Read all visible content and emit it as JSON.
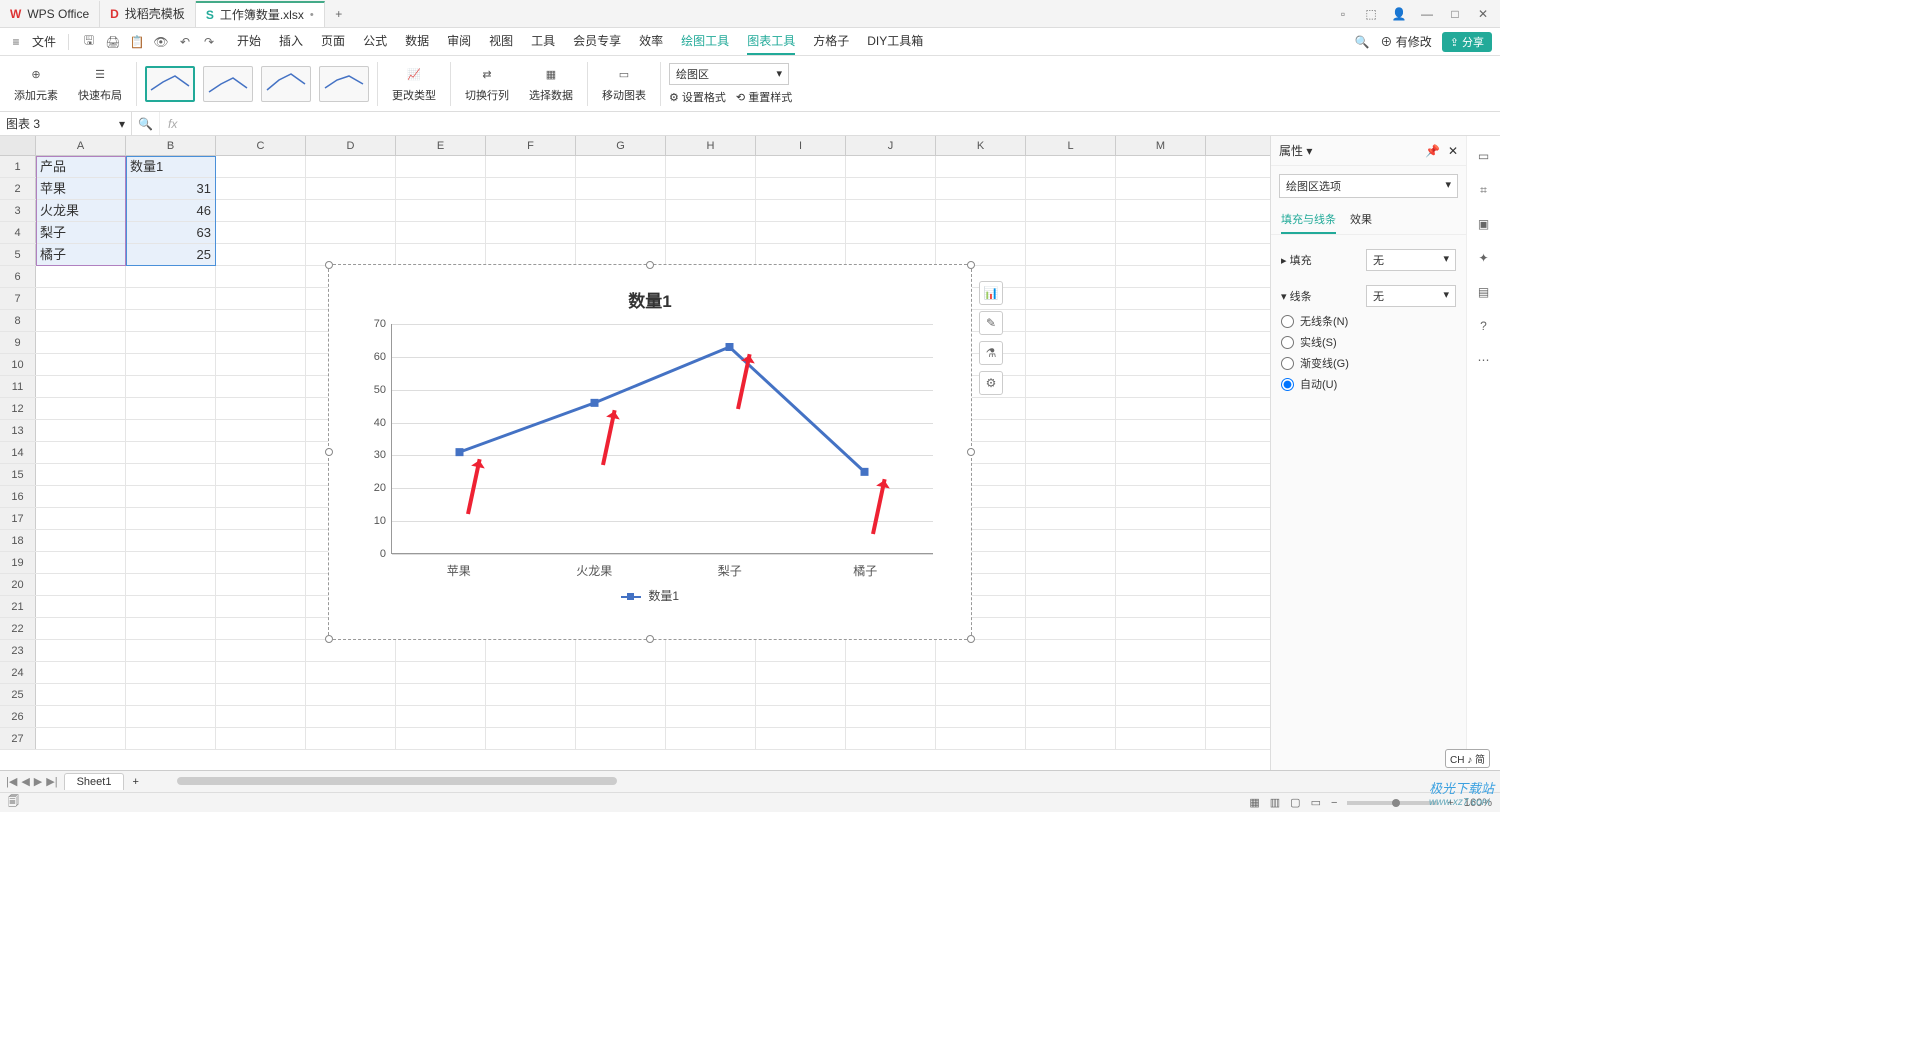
{
  "tabs": {
    "items": [
      {
        "icon": "W",
        "label": "WPS Office",
        "iconColor": "#d33"
      },
      {
        "icon": "D",
        "label": "找稻壳模板",
        "iconColor": "#d33"
      },
      {
        "icon": "S",
        "label": "工作簿数量.xlsx",
        "iconColor": "#2a9",
        "active": true,
        "dirty": "•"
      }
    ],
    "add": "+"
  },
  "windowControls": {
    "min": "—",
    "max": "□",
    "close": "✕"
  },
  "fileMenu": {
    "burger": "≡",
    "label": "文件"
  },
  "quickAccess": [
    "🖫",
    "🖨",
    "📋",
    "👁",
    "↶",
    "↷"
  ],
  "menuTabs": [
    "开始",
    "插入",
    "页面",
    "公式",
    "数据",
    "审阅",
    "视图",
    "工具",
    "会员专享",
    "效率",
    "绘图工具",
    "图表工具",
    "方格子",
    "DIY工具箱"
  ],
  "menuActiveIndex": 11,
  "menuGreenIndexes": [
    10,
    11
  ],
  "menuRight": {
    "search": "🔍",
    "pending": "⊕ 有修改",
    "share": "⇪ 分享"
  },
  "ribbon": {
    "addElement": "添加元素",
    "quickLayout": "快速布局",
    "changeType": "更改类型",
    "switchRowCol": "切换行列",
    "selectData": "选择数据",
    "moveChart": "移动图表",
    "areaSelect": "绘图区",
    "setFormat": "⚙ 设置格式",
    "resetStyle": "⟲ 重置样式"
  },
  "nameBox": "图表 3",
  "fxPlaceholder": "fx",
  "columns": [
    "A",
    "B",
    "C",
    "D",
    "E",
    "F",
    "G",
    "H",
    "I",
    "J",
    "K",
    "L",
    "M"
  ],
  "rowCount": 27,
  "cells": {
    "A1": "产品",
    "B1": "数量1",
    "A2": "苹果",
    "B2": "31",
    "A3": "火龙果",
    "B3": "46",
    "A4": "梨子",
    "B4": "63",
    "A5": "橘子",
    "B5": "25"
  },
  "chart_data": {
    "type": "line",
    "title": "数量1",
    "categories": [
      "苹果",
      "火龙果",
      "梨子",
      "橘子"
    ],
    "series": [
      {
        "name": "数量1",
        "values": [
          31,
          46,
          63,
          25
        ]
      }
    ],
    "ylim": [
      0,
      70
    ],
    "ystep": 10,
    "xlabel": "",
    "ylabel": ""
  },
  "chartFloat": [
    "📊",
    "✎",
    "⚗",
    "⚙"
  ],
  "sidePanel": {
    "title": "属性",
    "optionsLabel": "绘图区选项",
    "tabs": [
      "填充与线条",
      "效果"
    ],
    "activeTab": 0,
    "fill": {
      "label": "填充",
      "value": "无"
    },
    "line": {
      "label": "线条",
      "value": "无",
      "radios": [
        {
          "label": "无线条(N)",
          "checked": false
        },
        {
          "label": "实线(S)",
          "checked": false
        },
        {
          "label": "渐变线(G)",
          "checked": false
        },
        {
          "label": "自动(U)",
          "checked": true
        }
      ]
    }
  },
  "sideStrip": [
    "▭",
    "⌗",
    "▣",
    "✦",
    "▤",
    "?",
    "⋯"
  ],
  "sheetTabs": {
    "nav": [
      "|◀",
      "◀",
      "▶",
      "▶|"
    ],
    "active": "Sheet1",
    "add": "+"
  },
  "statusbar": {
    "left": "🗐",
    "views": [
      "▦",
      "▥",
      "▢",
      "▭"
    ],
    "zoomMinus": "−",
    "zoomPlus": "+",
    "zoom": "160%"
  },
  "ime": "CH ♪ 简",
  "watermark": {
    "line1": "极光下载站",
    "line2": "www.xz7.com"
  }
}
